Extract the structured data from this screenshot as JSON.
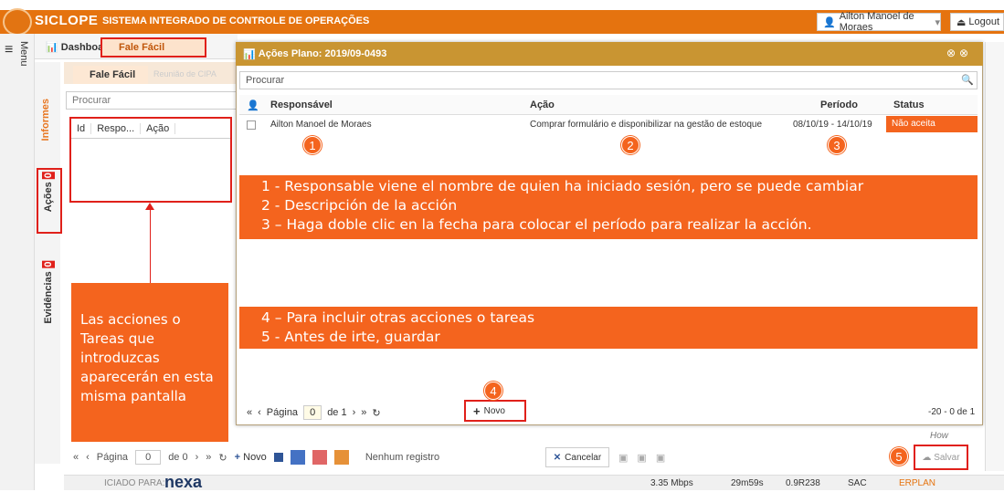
{
  "app": {
    "logo": "SICLOPE",
    "system_name": "SISTEMA INTEGRADO DE CONTROLE DE OPERAÇÕES",
    "user": "Ailton Manoel de Moraes",
    "logout": "Logout",
    "menu_label": "Menu",
    "brand_color": "#e5730f"
  },
  "tabs": {
    "dashboard": "Dashboard",
    "fale_facil": "Fale Fácil"
  },
  "side_tabs": {
    "informes": "Informes",
    "acoes": "Ações",
    "acoes_count": "0",
    "evidencias": "Evidências",
    "evidencias_count": "0"
  },
  "inner": {
    "tab": "Fale Fácil",
    "tab2": "Reunião de CIPA",
    "search_placeholder": "Procurar",
    "columns": [
      "Id",
      "Respo...",
      "Ação"
    ]
  },
  "modal": {
    "title": "Ações Plano: 2019/09-0493",
    "search_placeholder": "Procurar",
    "columns": {
      "responsavel": "Responsável",
      "acao": "Ação",
      "periodo": "Período",
      "status": "Status"
    },
    "row": {
      "responsavel": "Ailton Manoel de Moraes",
      "acao": "Comprar formulário e disponibilizar na gestão de estoque",
      "periodo": "08/10/19 - 14/10/19",
      "status": "Não aceita"
    },
    "pager": {
      "pagina": "Página",
      "page": "0",
      "de": "de 1",
      "novo": "Novo",
      "count": "-20 - 0 de 1"
    }
  },
  "annotations": {
    "n1": "1",
    "n2": "2",
    "n3": "3",
    "n4": "4",
    "n5": "5",
    "band1_l1": "1 - Responsable viene el nombre de quien ha iniciado sesión, pero se puede cambiar",
    "band1_l2": "2 - Descripción de la acción",
    "band1_l3": "3 – Haga doble clic en la fecha para colocar el período para realizar la acción.",
    "band2_l1": "4 – Para incluir otras acciones o tareas",
    "band2_l2": "5 - Antes de irte, guardar",
    "left": "Las acciones o Tareas que introduzcas aparecerán en esta misma pantalla"
  },
  "bottom": {
    "pagina": "Página",
    "page": "0",
    "de": "de 0",
    "novo": "Novo",
    "nenhum": "Nenhum registro",
    "cancelar": "Cancelar",
    "salvar": "Salvar",
    "how": "How"
  },
  "status": {
    "iniciado": "ICIADO PARA:",
    "brand": "nexa",
    "mbps": "3.35 Mbps",
    "time": "29m59s",
    "code": "0.9R238",
    "sac": "SAC",
    "erplan": "ERPLAN"
  }
}
